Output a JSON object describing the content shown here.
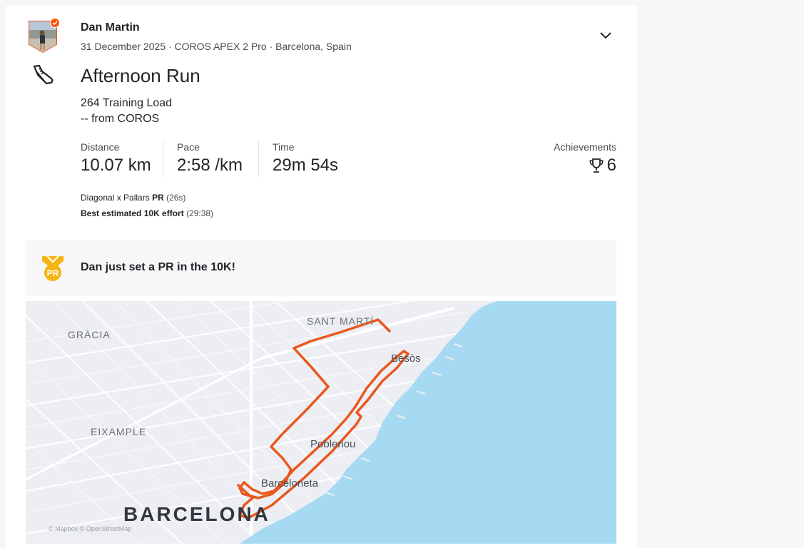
{
  "athlete": {
    "name": "Dan Martin",
    "meta": "31 December 2025 · COROS APEX 2 Pro · Barcelona, Spain"
  },
  "activity": {
    "sport_icon": "running-shoe-icon",
    "title": "Afternoon Run",
    "training_load": "264 Training Load",
    "source": "-- from COROS"
  },
  "stats": {
    "distance": {
      "label": "Distance",
      "value": "10.07 km"
    },
    "pace": {
      "label": "Pace",
      "value": "2:58 /km"
    },
    "time": {
      "label": "Time",
      "value": "29m 54s"
    },
    "achievements": {
      "label": "Achievements",
      "count": "6",
      "icon": "trophy-icon"
    }
  },
  "segments": [
    {
      "name": "Diagonal x Pallars",
      "badge": "PR",
      "detail": "(26s)"
    },
    {
      "name": "Best estimated 10K effort",
      "detail": "(29:38)"
    }
  ],
  "pr_banner": {
    "icon": "pr-medal-icon",
    "text": "Dan just set a PR in the 10K!"
  },
  "map": {
    "labels": {
      "gracia": "GRÀCIA",
      "sant_marti": "SANT MARTÍ",
      "eixample": "EIXAMPLE",
      "besos": "Besòs",
      "poblenou": "Poblenou",
      "barceloneta": "Barceloneta",
      "barcelona": "BARCELONA"
    },
    "attribution": "© Mapbox © OpenStreetMap",
    "route_color": "#e9581e",
    "sea_color": "#a6daf2"
  },
  "colors": {
    "accent": "#fc5200",
    "text": "#242428",
    "pr_gold": "#f5b512"
  }
}
